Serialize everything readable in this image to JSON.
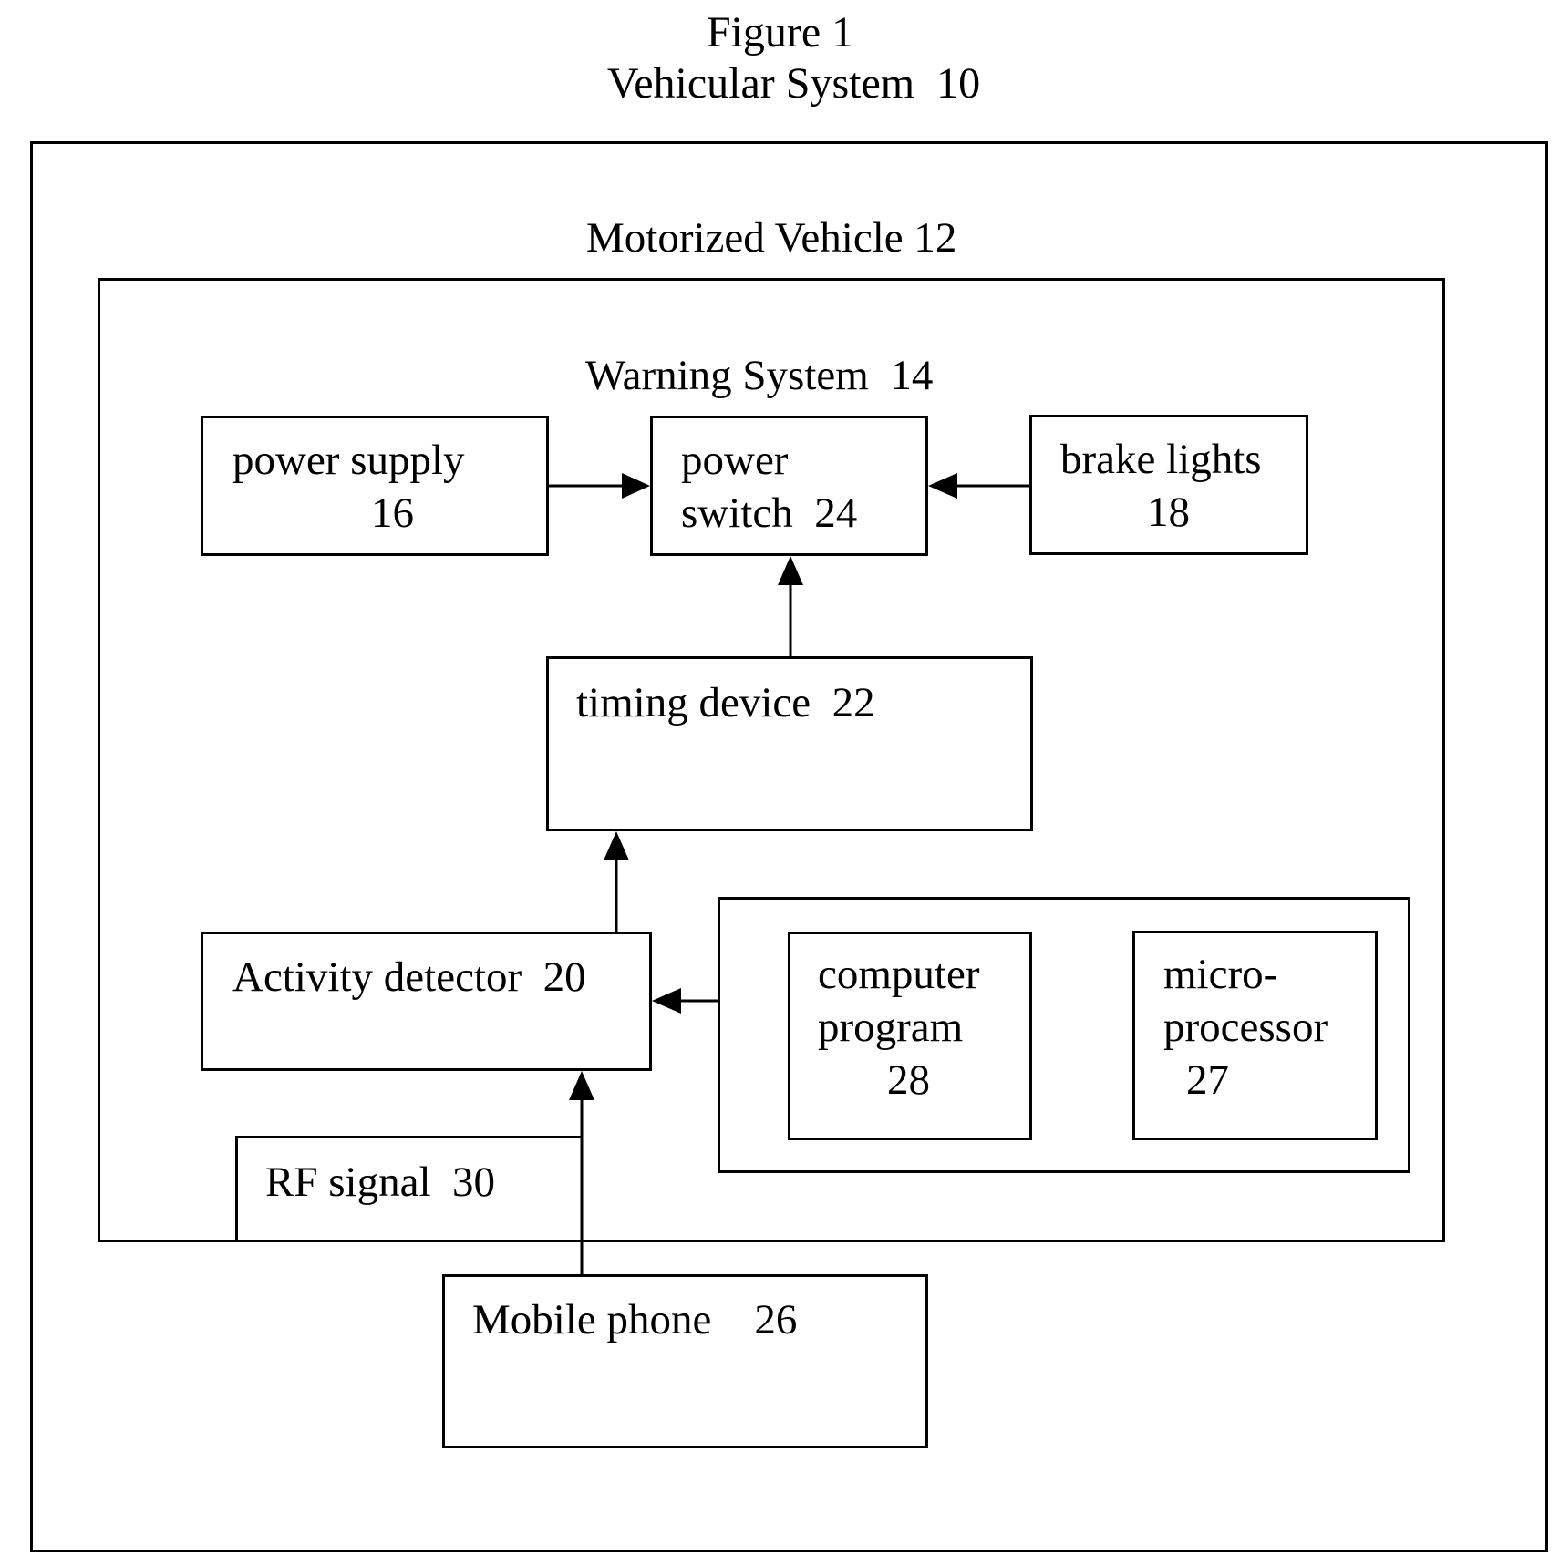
{
  "figure": {
    "title": "Figure 1",
    "subtitle": "Vehicular System  10"
  },
  "containers": {
    "vehicle_label": "Motorized Vehicle 12",
    "warning_system_label": "Warning System  14"
  },
  "blocks": {
    "power_supply": {
      "line1": "power supply",
      "line2": "16"
    },
    "power_switch": {
      "line1": "power",
      "line2": "switch  24"
    },
    "brake_lights": {
      "line1": "brake lights",
      "line2": "18"
    },
    "timing_device": {
      "line1": "timing device  22"
    },
    "activity_detector": {
      "line1": "Activity detector  20"
    },
    "computer_program": {
      "line1": "computer",
      "line2": "program",
      "line3": "28"
    },
    "microprocessor": {
      "line1": "micro-",
      "line2": "processor",
      "line3": "27"
    },
    "rf_signal": {
      "line1": "RF signal  30"
    },
    "mobile_phone": {
      "line1": "Mobile phone    26"
    }
  },
  "connections": [
    {
      "from": "power supply 16",
      "to": "power switch 24"
    },
    {
      "from": "brake lights 18",
      "to": "power switch 24"
    },
    {
      "from": "timing device 22",
      "to": "power switch 24"
    },
    {
      "from": "activity detector 20",
      "to": "timing device 22"
    },
    {
      "from": "processing group (computer program 28, microprocessor 27)",
      "to": "activity detector 20"
    },
    {
      "from": "mobile phone 26",
      "to": "activity detector 20"
    }
  ]
}
